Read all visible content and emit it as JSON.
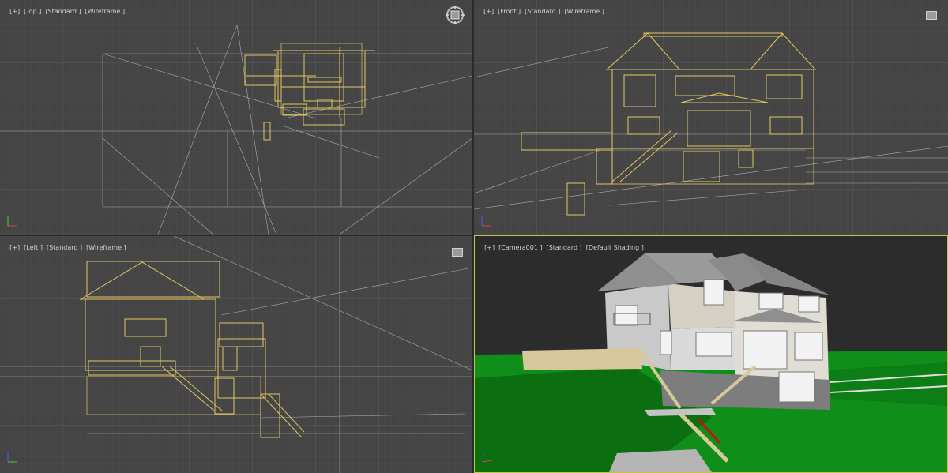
{
  "viewports": {
    "top": {
      "menu": "[+]",
      "view": "[Top ]",
      "quality": "[Standard ]",
      "shading": "[Wireframe ]"
    },
    "front": {
      "menu": "[+]",
      "view": "[Front ]",
      "quality": "[Standard ]",
      "shading": "[Wireframe ]"
    },
    "left": {
      "menu": "[+]",
      "view": "[Left ]",
      "quality": "[Standard ]",
      "shading": "[Wireframe ]"
    },
    "camera": {
      "menu": "[+]",
      "view": "[Camera001 ]",
      "quality": "[Standard ]",
      "shading": "[Default Shading ]"
    }
  },
  "colors": {
    "viewport_bg": "#454545",
    "camera_bg": "#2c2c2c",
    "grid_minor": "#505050",
    "grid_major": "#5c5c5c",
    "wireframe": "#e3c862",
    "wireframe_dim": "#b89d45",
    "guide_lines": "#cfcfcf",
    "active_border": "#c8c24a",
    "grass": "#0f8f1a",
    "grass_dark": "#0b6f12",
    "wall_light": "#c9c9c9",
    "roof": "#8f8f8f",
    "deck": "#d8c79a"
  },
  "icons": {
    "top_nav": "viewcube-compass-icon",
    "small_cube": "viewcube-icon",
    "axis_tripod": "axis-tripod-icon"
  }
}
